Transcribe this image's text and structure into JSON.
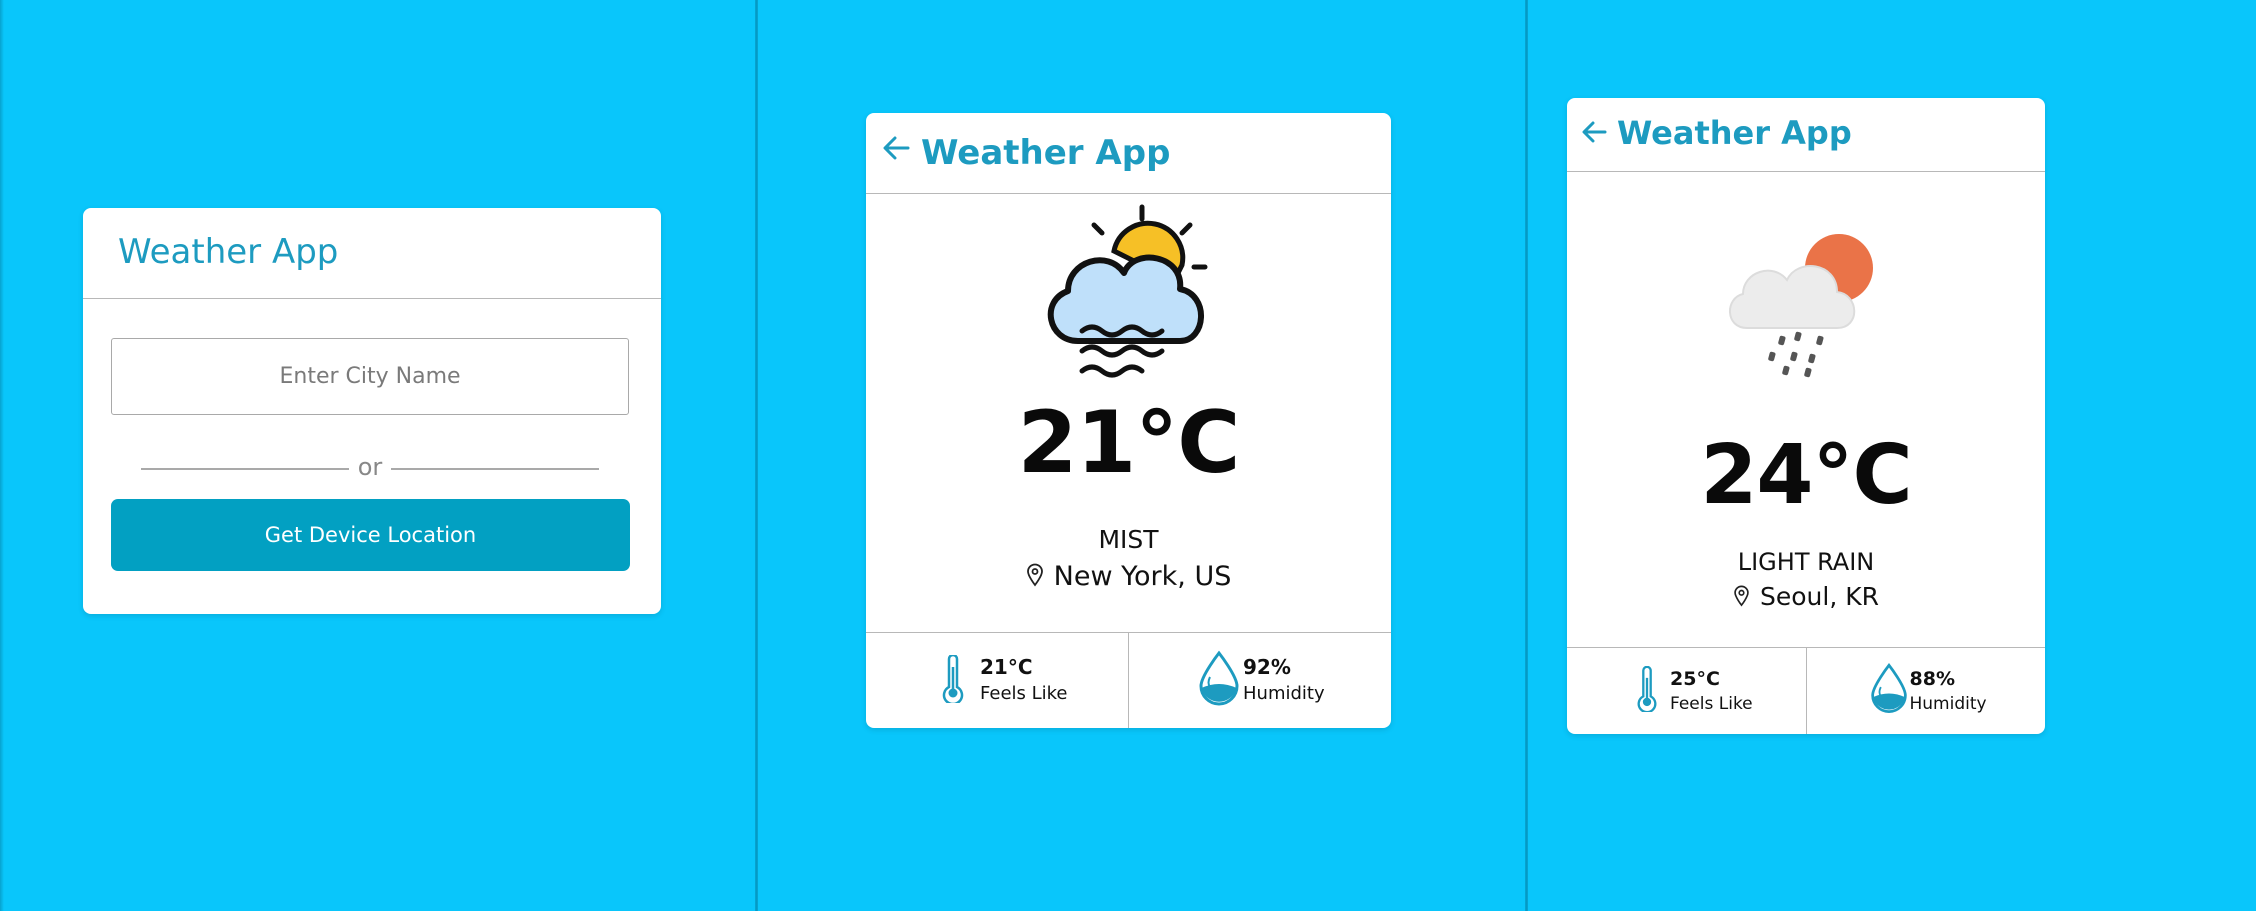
{
  "screens": {
    "search": {
      "title": "Weather App",
      "city_input_placeholder": "Enter City Name",
      "city_input_value": "",
      "divider_text": "or",
      "device_location_button": "Get Device Location"
    },
    "new_york": {
      "title": "Weather App",
      "back_icon": "arrow-left-icon",
      "weather_icon": "sun-cloud-mist-icon",
      "temperature": "21°C",
      "description": "MIST",
      "location": "New York, US",
      "feels_like_value": "21°C",
      "feels_like_label": "Feels Like",
      "humidity_value": "92%",
      "humidity_label": "Humidity"
    },
    "seoul": {
      "title": "Weather App",
      "back_icon": "arrow-left-icon",
      "weather_icon": "sun-cloud-rain-icon",
      "temperature": "24°C",
      "description": "LIGHT RAIN",
      "location": "Seoul, KR",
      "feels_like_value": "25°C",
      "feels_like_label": "Feels Like",
      "humidity_value": "88%",
      "humidity_label": "Humidity"
    }
  },
  "colors": {
    "background": "#09c6fb",
    "accent": "#1d9bc0",
    "button": "#02a0c2",
    "card": "#ffffff"
  }
}
